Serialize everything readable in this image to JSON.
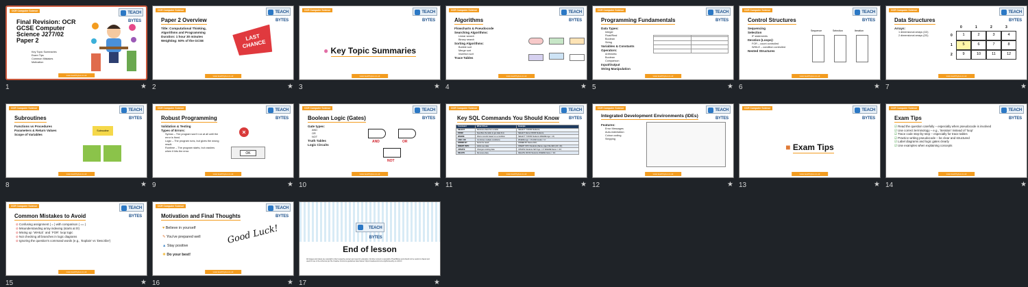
{
  "slides": [
    {
      "num": "1",
      "title": "Final Revision: OCR GCSE Computer Science J277/02 Paper 2",
      "items": [
        "Key Topic Summaries",
        "Exam Tips",
        "Common Mistakes",
        "Motivation"
      ]
    },
    {
      "num": "2",
      "title": "Paper 2 Overview",
      "items": [
        "Title: Computational Thinking, Algorithms and Programming",
        "Duration: 1 hour 30 minutes",
        "Weighting: 50% of the GCSE"
      ],
      "sticker": "LAST CHANCE"
    },
    {
      "num": "3",
      "title": "Key Topic Summaries"
    },
    {
      "num": "4",
      "title": "Algorithms",
      "items": [
        "Flowcharts & Pseudocode",
        "Searching Algorithms:",
        "Linear search",
        "Binary search",
        "Sorting Algorithms:",
        "Bubble sort",
        "Merge sort",
        "Insertion sort",
        "Trace Tables"
      ]
    },
    {
      "num": "5",
      "title": "Programming Fundamentals",
      "items": [
        "Data Types:",
        "Integer",
        "Float/Real",
        "Boolean",
        "String",
        "Variables & Constants",
        "Operators:",
        "Arithmetic",
        "Boolean",
        "Comparison",
        "Input/Output",
        "String Manipulation"
      ]
    },
    {
      "num": "6",
      "title": "Control Structures",
      "items": [
        "Sequencing",
        "Selection",
        "IF statements",
        "Iteration (Loops):",
        "FOR – count controlled",
        "WHILE – condition controlled",
        "Nested Structures"
      ],
      "labels": [
        "Sequence",
        "Selection",
        "Iteration"
      ]
    },
    {
      "num": "7",
      "title": "Data Structures",
      "items": [
        "Arrays:",
        "1 dimensional arrays (1D)",
        "2 dimensional arrays (2D)"
      ],
      "grid_cols": [
        "0",
        "1",
        "2",
        "3"
      ],
      "grid_rows": [
        "0",
        "1",
        "2"
      ],
      "grid_vals": [
        "1",
        "2",
        "3",
        "4",
        "5",
        "6",
        "7",
        "8",
        "9",
        "10",
        "11",
        "12"
      ]
    },
    {
      "num": "8",
      "title": "Subroutines",
      "items": [
        "Functions vs Procedures",
        "Parameters & Return Values",
        "Scope of Variables"
      ],
      "notes": [
        "Subroutine"
      ]
    },
    {
      "num": "9",
      "title": "Robust Programming",
      "items": [
        "Validation & Testing",
        "Types of Errors:",
        "Syntax – The program won't run at all until the error is fixed.",
        "Logic – The program runs, but gives the wrong result.",
        "Runtime – The program starts, but crashes when it hits the error."
      ],
      "ok": "OK"
    },
    {
      "num": "10",
      "title": "Boolean Logic (Gates)",
      "items": [
        "Gate types:",
        "AND",
        "OR",
        "NOT",
        "Truth Tables",
        "Logic Circuits"
      ],
      "gates": [
        "AND",
        "OR",
        "NOT"
      ]
    },
    {
      "num": "11",
      "title": "Key SQL Commands You Should Know",
      "head": [
        "Command",
        "What It Does",
        "Example"
      ],
      "rows": [
        [
          "SELECT",
          "Retrieves data from a table",
          "SELECT * FROM Students;"
        ],
        [
          "FROM",
          "Specifies the table to get data from",
          "SELECT Name FROM Students;"
        ],
        [
          "WHERE",
          "Filters records based on a condition",
          "SELECT * FROM Students WHERE Age > 16;"
        ],
        [
          "AND / OR",
          "Combines multiple conditions",
          "WHERE Age > 15 AND Grade = 'A'"
        ],
        [
          "ORDER BY",
          "Sorts the result",
          "ORDER BY Name ASC;"
        ],
        [
          "INSERT INTO",
          "Adds new data",
          "INSERT INTO Students (Name, Age) VALUES ('Ali', 16);"
        ],
        [
          "UPDATE",
          "Changes existing data",
          "UPDATE Students SET Age = 17 WHERE Name = 'Ali';"
        ],
        [
          "DELETE",
          "Removes data",
          "DELETE FROM Students WHERE Name = 'Ali';"
        ]
      ]
    },
    {
      "num": "12",
      "title": "Integrated Development Environments (IDEs)",
      "items": [
        "Features:",
        "Error Messages",
        "Auto-indentation",
        "Colour coding",
        "Stepping"
      ]
    },
    {
      "num": "13",
      "title": "Exam Tips"
    },
    {
      "num": "14",
      "title": "Exam Tips",
      "items": [
        "Read the question carefully – especially when pseudocode is involved",
        "Use correct terminology – e.g., 'iteration' instead of 'loop'",
        "Trace code step-by-step – especially for trace tables",
        "Practice writing pseudocode – be clear and structured",
        "Label diagrams and logic gates clearly",
        "Use examples when explaining concepts"
      ]
    },
    {
      "num": "15",
      "title": "Common Mistakes to Avoid",
      "items": [
        "Confusing assignment ( = ) with comparison ( == )",
        "Misunderstanding array indexing (starts at 0!)",
        "Mixing up `WHILE` and `FOR` loop logic",
        "Not checking all branches in logic diagrams",
        "Ignoring the question's command words (e.g., 'Explain' vs 'Describe')"
      ]
    },
    {
      "num": "16",
      "title": "Motivation and Final Thoughts",
      "items": [
        "Believe in yourself",
        "You've prepared well",
        "Stay positive",
        "Do your best!"
      ],
      "handwriting": "Good Luck!"
    },
    {
      "num": "17",
      "title": "End of lesson",
      "small": "All images and videos are copyright to their respective owners and used for education. All other content is copyright of TeachBytes and should not be resold or shared and used for use in the school as per the Creative Commons guidelines listed below: https://creativecommons.org/licenses/by-nc-nd/4.0/"
    }
  ],
  "common": {
    "tag": "OCR Computer Science",
    "logo": "TEACH BYTES",
    "footer": "www.teachbytes.co.uk"
  },
  "colors": {
    "accent": "#f39c1f",
    "selected": "#c9573b",
    "background": "#1f2328"
  }
}
